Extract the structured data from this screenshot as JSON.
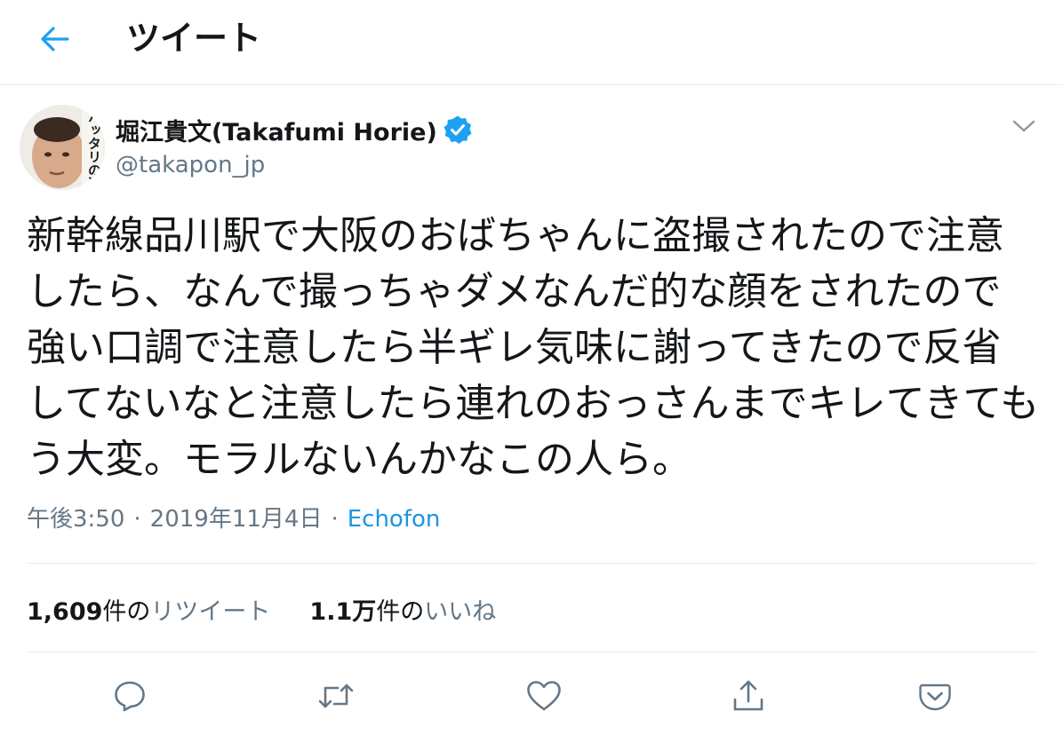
{
  "header": {
    "title": "ツイート",
    "back_icon": "arrow-left-icon"
  },
  "author": {
    "name": "堀江貴文(Takafumi Horie)",
    "handle": "@takapon_jp",
    "verified": true,
    "avatar_text": "ハッタリの流"
  },
  "tweet": {
    "text": "新幹線品川駅で大阪のおばちゃんに盗撮されたので注意したら、なんで撮っちゃダメなんだ的な顔をされたので強い口調で注意したら半ギレ気味に謝ってきたので反省してないなと注意したら連れのおっさんまでキレてきてもう大変。モラルないんかなこの人ら。",
    "time": "午後3:50",
    "date": "2019年11月4日",
    "separator": "·",
    "source": "Echofon"
  },
  "stats": {
    "retweets_count": "1,609",
    "retweets_unit": "件の",
    "retweets_label": "リツイート",
    "likes_count": "1.1万",
    "likes_unit": "件の",
    "likes_label": "いいね"
  },
  "actions": [
    {
      "icon": "reply-icon"
    },
    {
      "icon": "retweet-icon"
    },
    {
      "icon": "like-icon"
    },
    {
      "icon": "share-icon"
    },
    {
      "icon": "pocket-icon"
    }
  ],
  "colors": {
    "accent": "#1da1f2",
    "link": "#1b95e0",
    "text": "#14171a",
    "secondary": "#657786",
    "border": "#e6ecf0"
  }
}
